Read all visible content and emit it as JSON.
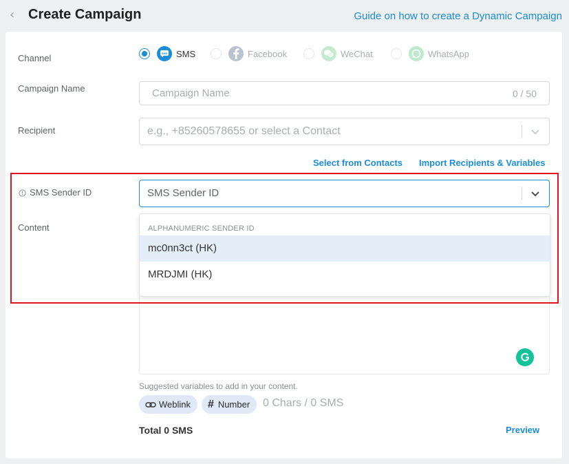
{
  "header": {
    "title": "Create Campaign",
    "guide_link": "Guide on how to create a Dynamic Campaign"
  },
  "form": {
    "channel": {
      "label": "Channel",
      "options": [
        {
          "label": "SMS",
          "selected": true,
          "icon": "sms-icon",
          "color": "#1a8cd8"
        },
        {
          "label": "Facebook",
          "selected": false,
          "icon": "facebook-icon",
          "color": "#1877f2"
        },
        {
          "label": "WeChat",
          "selected": false,
          "icon": "wechat-icon",
          "color": "#7bb32e"
        },
        {
          "label": "WhatsApp",
          "selected": false,
          "icon": "whatsapp-icon",
          "color": "#25d366"
        }
      ]
    },
    "campaign_name": {
      "label": "Campaign Name",
      "placeholder": "Campaign Name",
      "counter": "0 / 50"
    },
    "recipient": {
      "label": "Recipient",
      "placeholder": "e.g., +85260578655 or select a Contact",
      "select_from_contacts": "Select from Contacts",
      "import_link": "Import Recipients & Variables"
    },
    "sender_id": {
      "label": "SMS Sender ID",
      "placeholder": "SMS Sender ID",
      "dropdown": {
        "group_header": "ALPHANUMERIC SENDER ID",
        "options": [
          "mc0nn3ct (HK)",
          "MRDJMI (HK)"
        ],
        "highlighted_index": 0
      }
    },
    "content": {
      "label": "Content",
      "suggest_text": "Suggested variables to add in your content.",
      "chips": [
        "Weblink",
        "Number"
      ],
      "chars_info": "0 Chars / 0 SMS",
      "total": "Total 0 SMS",
      "preview": "Preview"
    }
  },
  "colors": {
    "accent": "#1a8cd8",
    "highlight_border": "#e0141e",
    "grammarly": "#15c39a"
  }
}
